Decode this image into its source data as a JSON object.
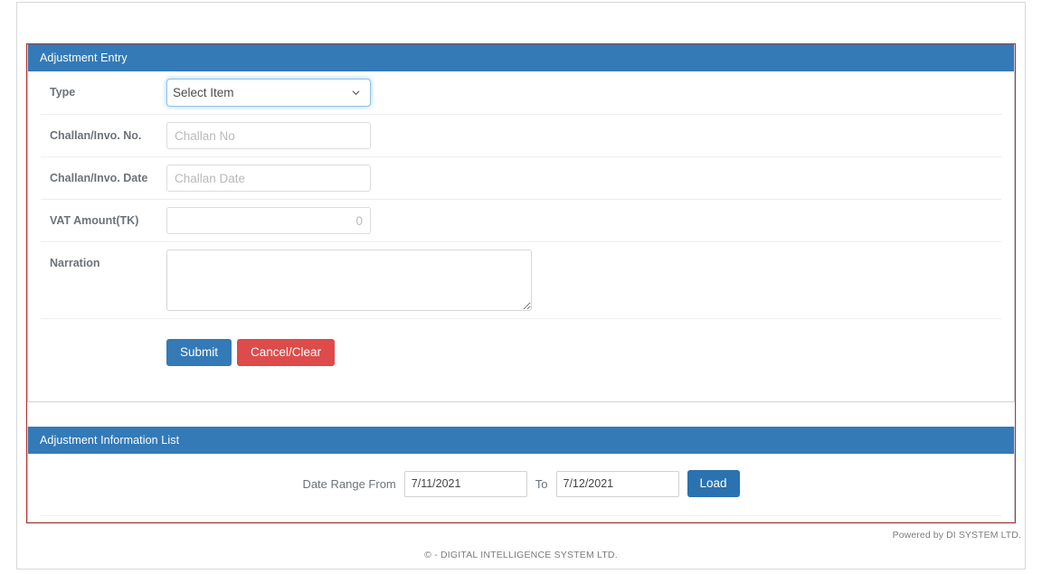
{
  "entry_panel": {
    "title": "Adjustment Entry",
    "fields": {
      "type": {
        "label": "Type",
        "selected": "Select Item",
        "options": [
          "Select Item"
        ]
      },
      "challan_no": {
        "label": "Challan/Invo. No.",
        "value": "",
        "placeholder": "Challan No"
      },
      "challan_date": {
        "label": "Challan/Invo. Date",
        "value": "",
        "placeholder": "Challan Date"
      },
      "vat_amount": {
        "label": "VAT Amount(TK)",
        "value": "0",
        "placeholder": "0"
      },
      "narration": {
        "label": "Narration",
        "value": "",
        "placeholder": ""
      }
    },
    "buttons": {
      "submit": "Submit",
      "cancel": "Cancel/Clear"
    }
  },
  "list_panel": {
    "title": "Adjustment Information List",
    "filter": {
      "from_label": "Date Range From",
      "from_value": "7/11/2021",
      "to_label": "To",
      "to_value": "7/12/2021",
      "load_button": "Load"
    }
  },
  "footer": {
    "powered_by": "Powered by DI SYSTEM LTD.",
    "copyright": "©  - DIGITAL INTELLIGENCE SYSTEM LTD."
  },
  "colors": {
    "panel_header": "#337ab7",
    "primary_button": "#337ab7",
    "danger_button": "#dd4b4b",
    "outer_border": "#b52b2b"
  }
}
